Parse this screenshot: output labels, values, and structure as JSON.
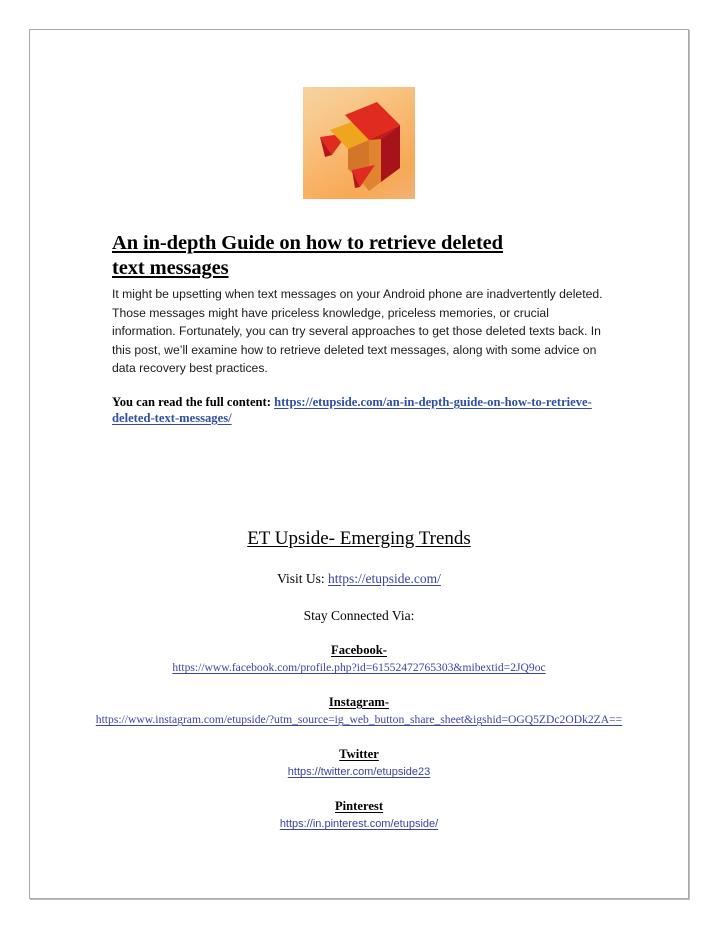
{
  "document": {
    "logo": {
      "name": "et-upside-logo",
      "background_start": "#f6d3a0",
      "background_end": "#f3b273",
      "red": "#e02b21",
      "dark_red": "#a8121a",
      "orange": "#f0a020",
      "dark_orange": "#d4762a"
    },
    "title": {
      "line1": "An in-depth Guide on how to retrieve deleted",
      "line2": "text messages"
    },
    "body": "It might be upsetting when text messages on your Android phone are inadvertently deleted. Those messages might have priceless knowledge, priceless memories, or crucial information. Fortunately, you can try several approaches to get those deleted texts back. In this post, we’ll examine how to retrieve deleted text messages, along with some advice on data recovery best practices.",
    "full_content": {
      "label": "You can read the full content:",
      "url": "https://etupside.com/an-in-depth-guide-on-how-to-retrieve-deleted-text-messages/",
      "link_color": "#2f4fa2"
    }
  },
  "footer": {
    "heading": "ET Upside- Emerging Trends",
    "visit_label": "Visit Us:",
    "visit_url": "https://etupside.com/",
    "stay_connected_label": "Stay Connected Via:",
    "socials": [
      {
        "name": "Facebook-",
        "url": "https://www.facebook.com/profile.php?id=61552472765303&mibextid=2JQ9oc"
      },
      {
        "name": "Instagram-",
        "url": "https://www.instagram.com/etupside/?utm_source=ig_web_button_share_sheet&igshid=OGQ5ZDc2ODk2ZA=="
      },
      {
        "name": "Twitter",
        "url": "https://twitter.com/etupside23"
      },
      {
        "name": "Pinterest",
        "url": "https://in.pinterest.com/etupside/"
      }
    ]
  }
}
